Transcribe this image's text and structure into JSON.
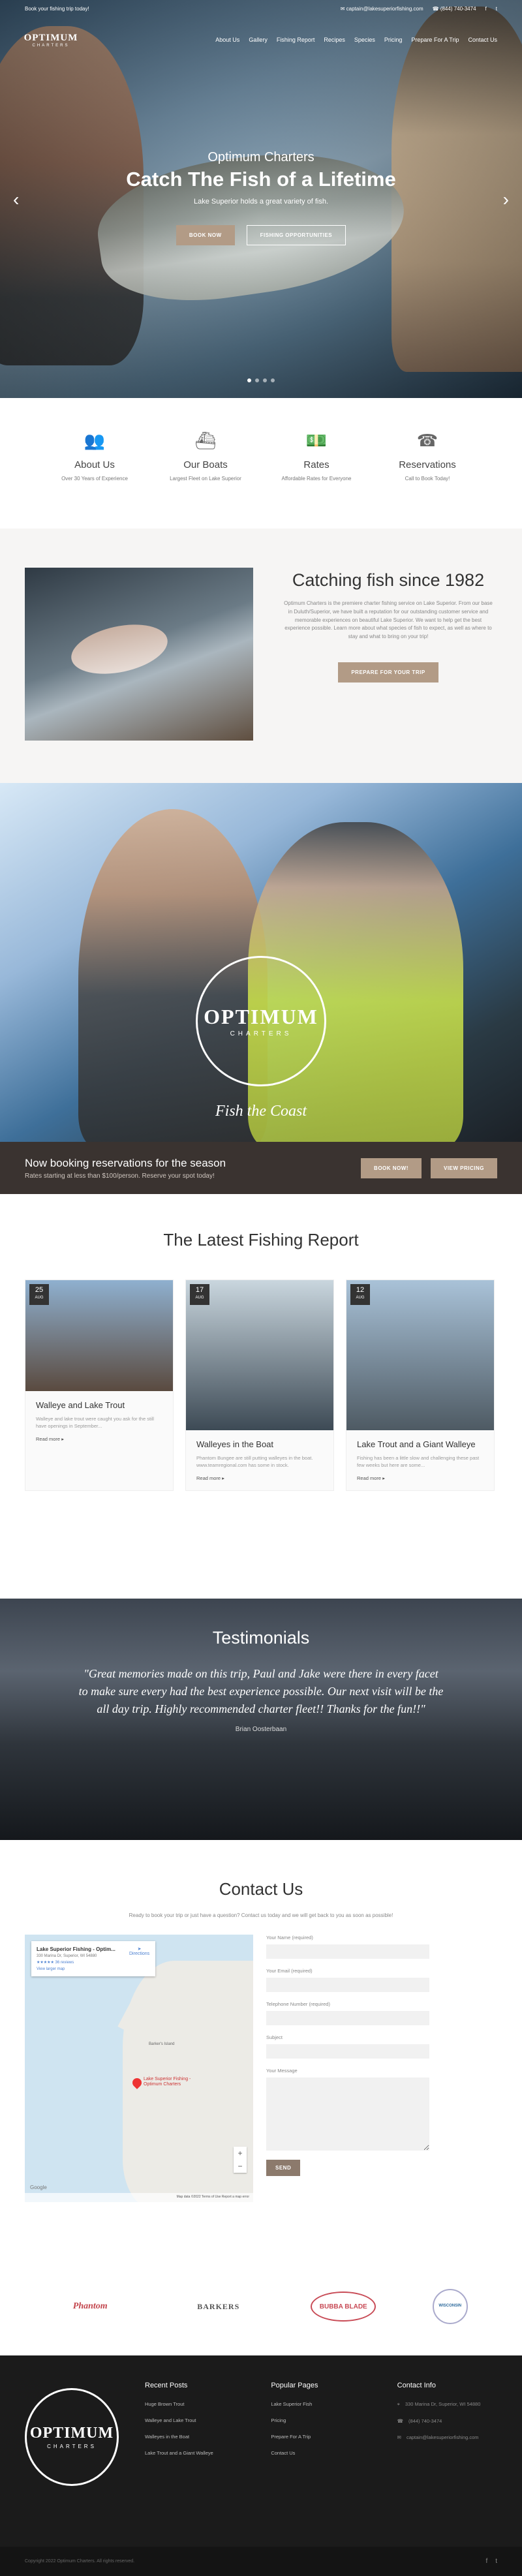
{
  "topbar": {
    "left_text": "Book your fishing trip today!",
    "email": "captain@lakesuperiorfishing.com",
    "phone": "(844) 740-3474"
  },
  "nav": {
    "logo_word": "OPTIMUM",
    "logo_sub": "CHARTERS",
    "items": [
      "About Us",
      "Gallery",
      "Fishing Report",
      "Recipes",
      "Species",
      "Pricing",
      "Prepare For A Trip",
      "Contact Us"
    ]
  },
  "hero": {
    "brand": "Optimum Charters",
    "title": "Catch The Fish of a Lifetime",
    "subtitle": "Lake Superior holds a great variety of fish.",
    "btn_book": "BOOK NOW",
    "btn_opps": "FISHING OPPORTUNITIES",
    "prev_icon": "‹",
    "next_icon": "›"
  },
  "features": [
    {
      "icon": "group-icon",
      "glyph": "👥",
      "title": "About Us",
      "text": "Over 30 Years of Experience"
    },
    {
      "icon": "boat-icon",
      "glyph": "⛴",
      "title": "Our Boats",
      "text": "Largest Fleet on Lake Superior"
    },
    {
      "icon": "money-icon",
      "glyph": "💵",
      "title": "Rates",
      "text": "Affordable Rates for Everyone"
    },
    {
      "icon": "phone-icon",
      "glyph": "☎",
      "title": "Reservations",
      "text": "Call to Book Today!"
    }
  ],
  "about": {
    "title": "Catching fish since 1982",
    "text": "Optimum Charters is the premiere charter fishing service on Lake Superior. From our base in Duluth/Superior, we have built a reputation for our outstanding customer service and memorable experiences on beautiful Lake Superior. We want to help get the best experience possible. Learn more about what species of fish to expect, as well as where to stay and what to bring on your trip!",
    "button": "PREPARE FOR YOUR TRIP"
  },
  "banner": {
    "logo_word": "OPTIMUM",
    "logo_sub": "CHARTERS",
    "tagline": "Fish the Coast"
  },
  "booking": {
    "title": "Now booking reservations for the season",
    "text": "Rates starting at less than $100/person. Reserve your spot today!",
    "btn_book": "BOOK NOW!",
    "btn_pricing": "VIEW PRICING"
  },
  "report": {
    "title": "The Latest Fishing Report",
    "read_more": "Read more",
    "cards": [
      {
        "day": "25",
        "month": "AUG",
        "title": "Walleye and Lake Trout",
        "excerpt": "Walleye and lake trout were caught you ask for the still have openings in September...",
        "img_a": "#8fb0cf",
        "img_b": "#5a4a3f"
      },
      {
        "day": "17",
        "month": "AUG",
        "title": "Walleyes in the Boat",
        "excerpt": "Phantom Bungee are still putting walleyes in the boat. www.teamregional.com has some in stock.",
        "img_a": "#c9d6de",
        "img_b": "#3d4a55"
      },
      {
        "day": "12",
        "month": "AUG",
        "title": "Lake Trout and a Giant Walleye",
        "excerpt": "Fishing has been a little slow and challenging these past few weeks but here are some...",
        "img_a": "#a9c2d8",
        "img_b": "#4e5a63"
      }
    ]
  },
  "testimonials": {
    "title": "Testimonials",
    "quote": "\"Great memories made on this trip, Paul and Jake were there in every facet to make sure every had the best experience possible. Our next visit will be the all day trip. Highly recommended charter fleet!! Thanks for the fun!!\"",
    "author": "Brian Oosterbaan"
  },
  "contact": {
    "title": "Contact Us",
    "intro": "Ready to book your trip or just have a question? Contact us today and we will get back to you as soon as possible!",
    "map": {
      "place_name": "Lake Superior Fishing - Optim...",
      "address": "330 Marina Dr, Superior, WI 54880",
      "reviews": "★★★★★ 36 reviews",
      "larger_map": "View larger map",
      "directions": "Directions",
      "pin_label": "Lake Superior Fishing - Optimum Charters",
      "island": "Barker's Island",
      "footer": "Map data ©2022 Terms of Use Report a map error",
      "google": "Google",
      "zoom_in": "+",
      "zoom_out": "−"
    },
    "fields": {
      "name": "Your Name (required)",
      "email": "Your Email (required)",
      "phone": "Telephone Number (required)",
      "subject": "Subject",
      "message": "Your Message",
      "send": "SEND"
    }
  },
  "sponsors": [
    "Phantom",
    "BARKERS",
    "BUBBA BLADE",
    "WISCONSIN"
  ],
  "footer": {
    "logo_word": "OPTIMUM",
    "logo_sub": "CHARTERS",
    "recent_title": "Recent Posts",
    "recent": [
      "Huge Brown Trout",
      "Walleye and Lake Trout",
      "Walleyes in the Boat",
      "Lake Trout and a Giant Walleye"
    ],
    "popular_title": "Popular Pages",
    "popular": [
      "Lake Superior Fish",
      "Pricing",
      "Prepare For A Trip",
      "Contact Us"
    ],
    "info_title": "Contact Info",
    "address": "330 Marina Dr, Superior, WI 54880",
    "phone": "(844) 740-3474",
    "email": "captain@lakesuperiorfishing.com",
    "copyright": "Copyright 2022 Optimum Charters. All rights reserved.",
    "social": [
      "f",
      "t"
    ]
  },
  "colors": {
    "accent": "#b29b86",
    "dark_band": "#3a3330",
    "footer": "#1b1b1b"
  }
}
